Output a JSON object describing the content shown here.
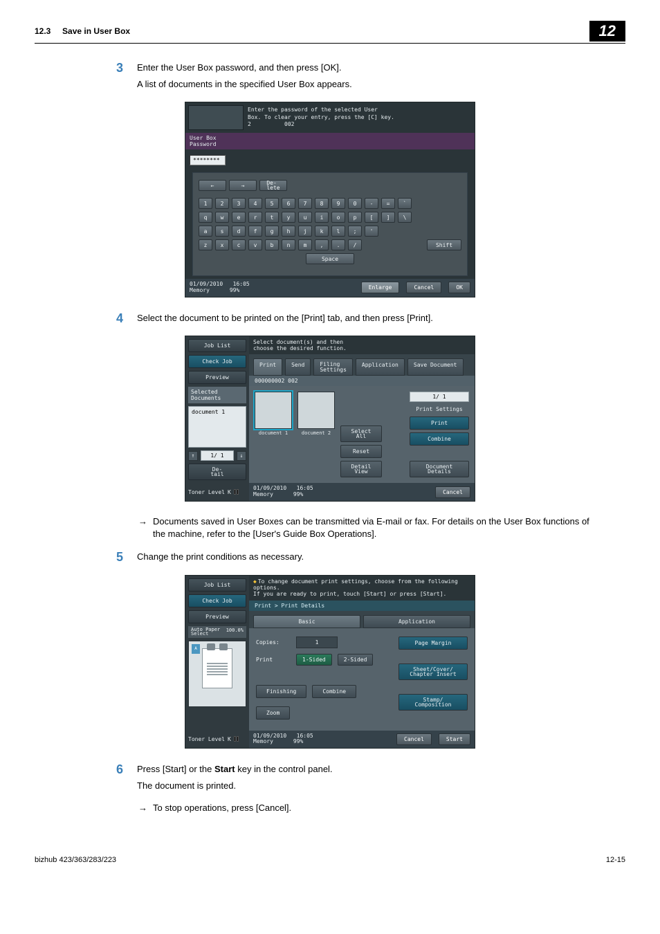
{
  "header": {
    "section_no": "12.3",
    "section_title": "Save in User Box",
    "chapter": "12"
  },
  "steps": {
    "s3": {
      "num": "3",
      "line1": "Enter the User Box password, and then press [OK].",
      "line2": "A list of documents in the specified User Box appears."
    },
    "s4": {
      "num": "4",
      "line1": "Select the document to be printed on the [Print] tab, and then press [Print].",
      "arrow": "Documents saved in User Boxes can be transmitted via E-mail or fax. For details on the User Box functions of the machine, refer to the [User's Guide Box Operations]."
    },
    "s5": {
      "num": "5",
      "line1": "Change the print conditions as necessary."
    },
    "s6": {
      "num": "6",
      "line1_a": "Press [Start] or the ",
      "line1_bold": "Start",
      "line1_b": " key in the control panel.",
      "line2": "The document is printed.",
      "arrow": "To stop operations, press [Cancel]."
    }
  },
  "mfp1": {
    "top_line1": "Enter the password of the selected User",
    "top_line2": "Box. To clear your entry, press the [C] key.",
    "top_num": "2",
    "top_box": "002",
    "userbox_label": "User Box\nPassword",
    "pw_value": "********",
    "nav": {
      "left": "←",
      "right": "→",
      "delete": "De-\nlete"
    },
    "rows": [
      [
        "1",
        "2",
        "3",
        "4",
        "5",
        "6",
        "7",
        "8",
        "9",
        "0",
        "-",
        "=",
        "`"
      ],
      [
        "q",
        "w",
        "e",
        "r",
        "t",
        "y",
        "u",
        "i",
        "o",
        "p",
        "[",
        "]",
        "\\"
      ],
      [
        "a",
        "s",
        "d",
        "f",
        "g",
        "h",
        "j",
        "k",
        "l",
        ";",
        "'"
      ],
      [
        "z",
        "x",
        "c",
        "v",
        "b",
        "n",
        "m",
        ",",
        ".",
        "/"
      ]
    ],
    "shift": "Shift",
    "space": "Space",
    "foot": {
      "date": "01/09/2010",
      "time": "16:05",
      "mem": "Memory",
      "memval": "99%",
      "enlarge": "Enlarge",
      "cancel": "Cancel",
      "ok": "OK"
    }
  },
  "mfp2": {
    "instr": "Select document(s) and then\nchoose the desired function.",
    "side": {
      "joblist": "Job List",
      "checkjob": "Check Job",
      "preview": "Preview",
      "selected_label": "Selected Documents",
      "selected_doc": "document 1",
      "page": "1/  1",
      "detail": "De-\ntail",
      "toner": "Toner Level",
      "toner_k": "K"
    },
    "tabs": {
      "print": "Print",
      "send": "Send",
      "filing": "Filing\nSettings",
      "app": "Application",
      "save": "Save Document"
    },
    "subbar": "000000002  002",
    "thumbs": {
      "d1": "document 1",
      "d2": "document 2"
    },
    "right": {
      "pg": "1/  1",
      "header": "Print Settings",
      "print": "Print",
      "combine": "Combine"
    },
    "mid": {
      "selectall": "Select\nAll",
      "reset": "Reset",
      "detailview": "Detail\nView",
      "docdetails": "Document\nDetails"
    },
    "foot": {
      "date": "01/09/2010",
      "time": "16:05",
      "mem": "Memory",
      "memval": "99%",
      "cancel": "Cancel"
    }
  },
  "mfp3": {
    "instr_l1": "To change document print settings, choose from the following options.",
    "instr_l2": "If you are ready to print, touch [Start] or press [Start].",
    "bread": "Print > Print Details",
    "side": {
      "joblist": "Job List",
      "checkjob": "Check Job",
      "preview": "Preview",
      "paper_mode": "Auto Paper\nSelect",
      "paper_pct": "100.0%",
      "a4": "A",
      "toner": "Toner Level",
      "toner_k": "K"
    },
    "tabs": {
      "basic": "Basic",
      "app": "Application"
    },
    "fields": {
      "copies_label": "Copies:",
      "copies_val": "1",
      "print_label": "Print",
      "onesided": "1-Sided",
      "twosided": "2-Sided"
    },
    "btns": {
      "finishing": "Finishing",
      "combine": "Combine",
      "zoom": "Zoom"
    },
    "right": {
      "pagemargin": "Page Margin",
      "sheet": "Sheet/Cover/\nChapter Insert",
      "stamp": "Stamp/\nComposition"
    },
    "foot": {
      "date": "01/09/2010",
      "time": "16:05",
      "mem": "Memory",
      "memval": "99%",
      "cancel": "Cancel",
      "start": "Start"
    }
  },
  "footer": {
    "left": "bizhub 423/363/283/223",
    "right": "12-15"
  }
}
